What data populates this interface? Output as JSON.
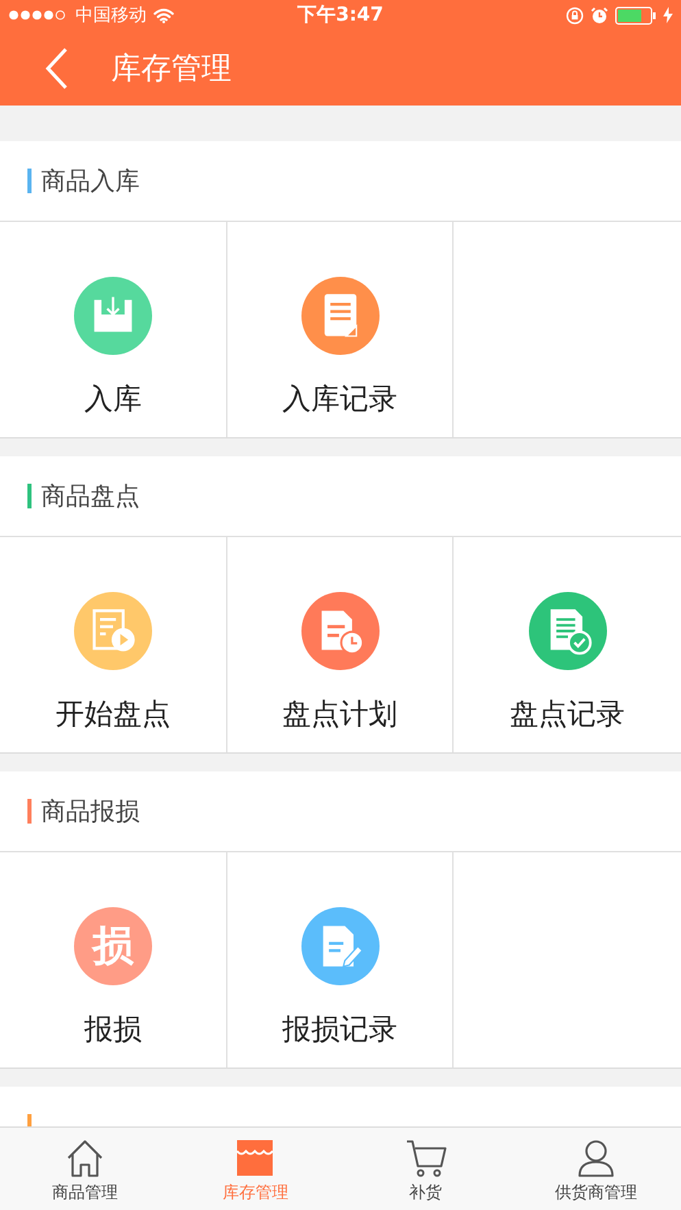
{
  "status_bar": {
    "carrier": "中国移动",
    "time": "下午3:47"
  },
  "header": {
    "title": "库存管理"
  },
  "sections": [
    {
      "title": "商品入库",
      "color": "#5ab4f0",
      "items": [
        {
          "label": "入库",
          "kind": "inbox",
          "color": "#56d99d"
        },
        {
          "label": "入库记录",
          "kind": "document",
          "color": "#ff8f4a"
        }
      ]
    },
    {
      "title": "商品盘点",
      "color": "#2ec27e",
      "items": [
        {
          "label": "开始盘点",
          "kind": "play-doc",
          "color": "#ffc86a"
        },
        {
          "label": "盘点计划",
          "kind": "clock-doc",
          "color": "#ff7a59"
        },
        {
          "label": "盘点记录",
          "kind": "check-doc",
          "color": "#2dc47a"
        }
      ]
    },
    {
      "title": "商品报损",
      "color": "#ff7f5c",
      "items": [
        {
          "label": "报损",
          "kind": "glyph",
          "glyph": "损",
          "color": "#ff9c86"
        },
        {
          "label": "报损记录",
          "kind": "edit-doc",
          "color": "#5bbdfb"
        }
      ]
    },
    {
      "color": "#ffa040"
    }
  ],
  "tabs": [
    {
      "label": "商品管理",
      "kind": "house",
      "selected": false
    },
    {
      "label": "库存管理",
      "kind": "store",
      "selected": true
    },
    {
      "label": "补货",
      "kind": "cart",
      "selected": false
    },
    {
      "label": "供货商管理",
      "kind": "person",
      "selected": false
    }
  ]
}
